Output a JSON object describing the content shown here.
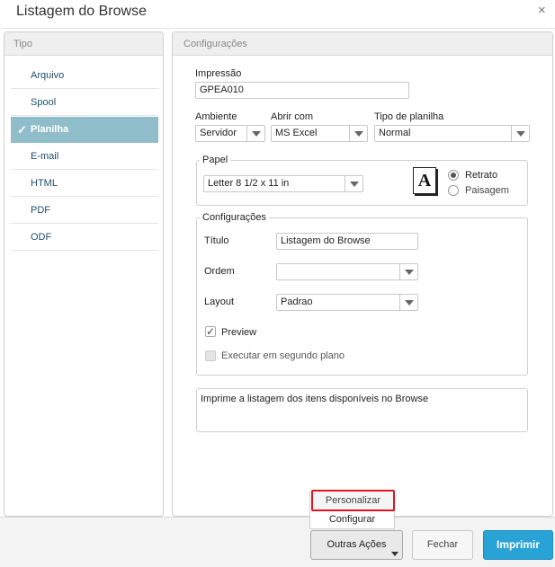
{
  "window": {
    "title": "Listagem do Browse",
    "close_glyph": "×"
  },
  "tipo": {
    "header": "Tipo",
    "items": [
      {
        "label": "Arquivo",
        "selected": false
      },
      {
        "label": "Spool",
        "selected": false
      },
      {
        "label": "Planilha",
        "selected": true
      },
      {
        "label": "E-mail",
        "selected": false
      },
      {
        "label": "HTML",
        "selected": false
      },
      {
        "label": "PDF",
        "selected": false
      },
      {
        "label": "ODF",
        "selected": false
      }
    ],
    "check_glyph": "✓"
  },
  "config": {
    "header": "Configurações",
    "impressao": {
      "label": "Impressão",
      "value": "GPEA010"
    },
    "ambiente": {
      "label": "Ambiente",
      "value": "Servidor"
    },
    "abrir_com": {
      "label": "Abrir com",
      "value": "MS Excel"
    },
    "tipo_planilha": {
      "label": "Tipo de planilha",
      "value": "Normal"
    },
    "papel": {
      "legend": "Papel",
      "size": "Letter 8 1/2 x 11 in",
      "orientation_icon": "A",
      "retrato": "Retrato",
      "paisagem": "Paisagem"
    },
    "configuracoes": {
      "legend": "Configurações",
      "titulo": {
        "label": "Título",
        "value": "Listagem do Browse"
      },
      "ordem": {
        "label": "Ordem",
        "value": ""
      },
      "layout": {
        "label": "Layout",
        "value": "Padrao"
      },
      "preview": {
        "label": "Preview",
        "checked": true
      },
      "segundo_plano": {
        "label": "Executar em segundo plano",
        "checked": false
      }
    },
    "description": "Imprime a listagem dos itens disponíveis no Browse"
  },
  "menu": {
    "personalizar": "Personalizar",
    "configurar": "Configurar"
  },
  "footer": {
    "outras_acoes": "Outras Ações",
    "fechar": "Fechar",
    "imprimir": "Imprimir"
  },
  "colors": {
    "accent": "#29a3d6",
    "selected": "#8fbdc9",
    "highlight": "#e0141e"
  }
}
